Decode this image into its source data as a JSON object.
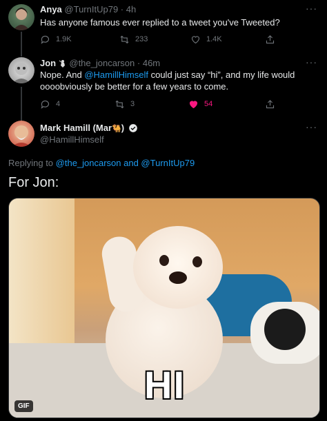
{
  "tweets": [
    {
      "name": "Anya",
      "handle": "@TurnItUp79",
      "dot": "·",
      "time": "4h",
      "text": "Has anyone famous ever replied to a tweet you've Tweeted?",
      "replies": "1.9K",
      "retweets": "233",
      "likes": "1.4K"
    },
    {
      "name": "Jon",
      "badge_icon": "ninja-icon",
      "handle": "@the_joncarson",
      "dot": "·",
      "time": "46m",
      "text_prefix": "Nope. And ",
      "mention": "@HamillHimself",
      "text_suffix": " could just say “hi”, and my life would oooobviously be better for a few years to come.",
      "replies": "4",
      "retweets": "3",
      "likes": "54",
      "liked_color": "#f91880"
    }
  ],
  "main_tweet": {
    "name": "Mark Hamill (Mar",
    "name_emoji": "🐫",
    "name_close": ")",
    "handle": "@HamillHimself",
    "replying_label": "Replying to ",
    "replying_users": "@the_joncarson and @TurnItUp79",
    "text": "For Jon:",
    "gif_caption": "HI",
    "gif_label": "GIF"
  },
  "more_label": "···",
  "colors": {
    "link": "#1d9bf0",
    "muted": "#71767b",
    "like": "#f91880"
  }
}
